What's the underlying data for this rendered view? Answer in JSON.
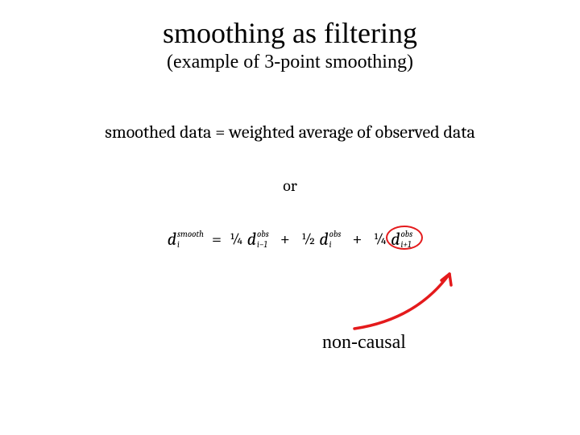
{
  "title": "smoothing as filtering",
  "subtitle": "(example of 3-point smoothing)",
  "sentence": "smoothed data = weighted average of observed data",
  "or": "or",
  "formula": {
    "lhs": {
      "var": "d",
      "sub": "i",
      "sup": "smooth"
    },
    "eq": "=",
    "terms": [
      {
        "coef": "¼",
        "var": "d",
        "sub": "i−1",
        "sup": "obs"
      },
      {
        "coef": "½",
        "var": "d",
        "sub": "i",
        "sup": "obs"
      },
      {
        "coef": "¼",
        "var": "d",
        "sub": "i+1",
        "sup": "obs"
      }
    ],
    "plus": "+"
  },
  "annotation": {
    "label": "non-causal",
    "color": "#e41a1c"
  }
}
